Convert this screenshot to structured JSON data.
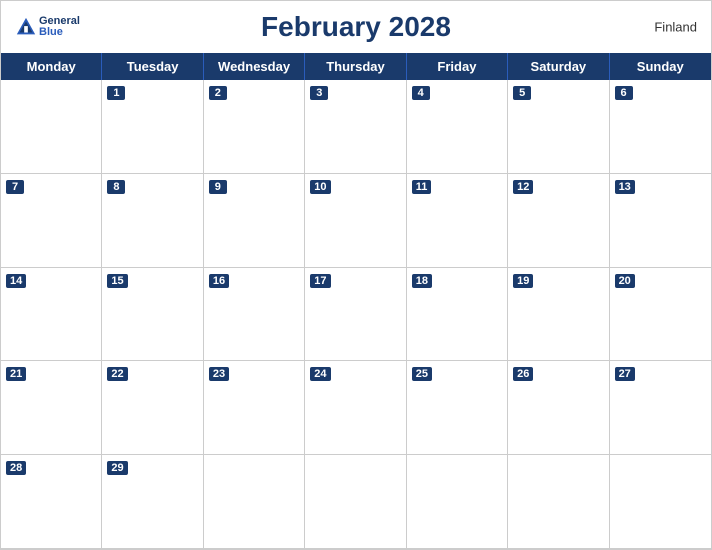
{
  "header": {
    "title": "February 2028",
    "country": "Finland",
    "logo": {
      "general": "General",
      "blue": "Blue"
    }
  },
  "days_of_week": [
    "Monday",
    "Tuesday",
    "Wednesday",
    "Thursday",
    "Friday",
    "Saturday",
    "Sunday"
  ],
  "weeks": [
    [
      {
        "number": "",
        "empty": true
      },
      {
        "number": "1"
      },
      {
        "number": "2"
      },
      {
        "number": "3"
      },
      {
        "number": "4"
      },
      {
        "number": "5"
      },
      {
        "number": "6"
      }
    ],
    [
      {
        "number": "7"
      },
      {
        "number": "8"
      },
      {
        "number": "9"
      },
      {
        "number": "10"
      },
      {
        "number": "11"
      },
      {
        "number": "12"
      },
      {
        "number": "13"
      }
    ],
    [
      {
        "number": "14"
      },
      {
        "number": "15"
      },
      {
        "number": "16"
      },
      {
        "number": "17"
      },
      {
        "number": "18"
      },
      {
        "number": "19"
      },
      {
        "number": "20"
      }
    ],
    [
      {
        "number": "21"
      },
      {
        "number": "22"
      },
      {
        "number": "23"
      },
      {
        "number": "24"
      },
      {
        "number": "25"
      },
      {
        "number": "26"
      },
      {
        "number": "27"
      }
    ],
    [
      {
        "number": "28"
      },
      {
        "number": "29"
      },
      {
        "number": "",
        "empty": true
      },
      {
        "number": "",
        "empty": true
      },
      {
        "number": "",
        "empty": true
      },
      {
        "number": "",
        "empty": true
      },
      {
        "number": "",
        "empty": true
      }
    ]
  ],
  "colors": {
    "header_bg": "#1a3a6b",
    "accent": "#2a5cbb",
    "text_white": "#ffffff",
    "border": "#cccccc"
  }
}
